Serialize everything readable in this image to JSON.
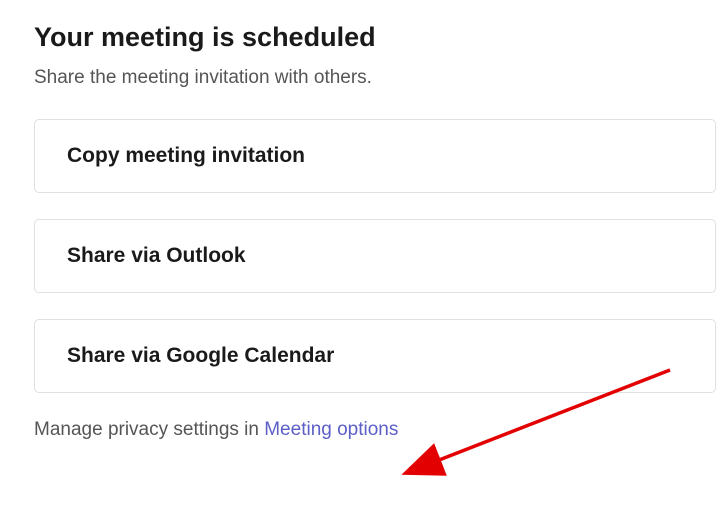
{
  "header": {
    "title": "Your meeting is scheduled",
    "subtitle": "Share the meeting invitation with others."
  },
  "options": [
    {
      "label": "Copy meeting invitation"
    },
    {
      "label": "Share via Outlook"
    },
    {
      "label": "Share via Google Calendar"
    }
  ],
  "footer": {
    "text_prefix": "Manage privacy settings in ",
    "link_text": "Meeting options"
  }
}
